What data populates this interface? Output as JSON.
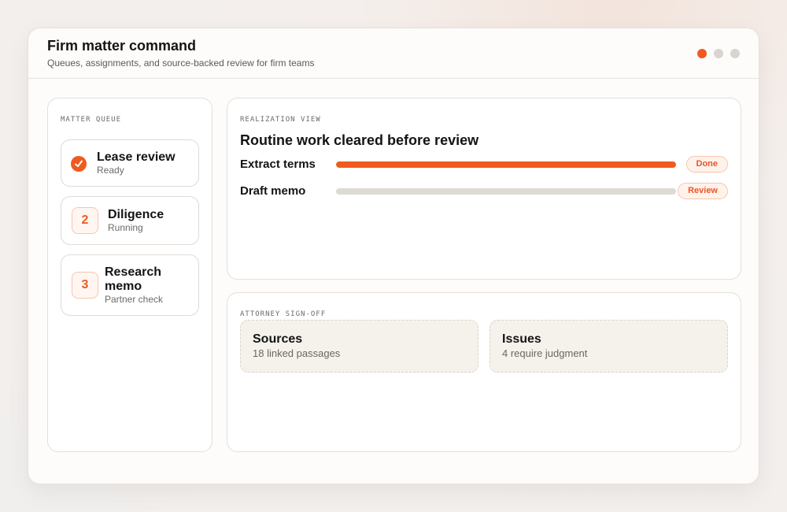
{
  "header": {
    "title": "Firm matter command",
    "subtitle": "Queues, assignments, and source-backed review for firm teams",
    "dots": [
      "active",
      "inactive",
      "inactive"
    ]
  },
  "queue": {
    "label": "MATTER QUEUE",
    "items": [
      {
        "title": "Lease review",
        "status": "Ready",
        "marker": "check-icon"
      },
      {
        "title": "Diligence",
        "status": "Running",
        "marker": "2"
      },
      {
        "title": "Research memo",
        "status": "Partner check",
        "marker": "3"
      }
    ]
  },
  "realization": {
    "label": "REALIZATION VIEW",
    "heading": "Routine work cleared before review",
    "tasks": [
      {
        "label": "Extract terms",
        "progress": 1.0,
        "status": "Done"
      },
      {
        "label": "Draft memo",
        "progress": 0.0,
        "status": "Review"
      }
    ]
  },
  "signoff": {
    "label": "ATTORNEY SIGN-OFF",
    "cards": [
      {
        "title": "Sources",
        "description": "18 linked passages"
      },
      {
        "title": "Issues",
        "description": "4 require judgment"
      }
    ]
  },
  "colors": {
    "accent": "#f05a1f",
    "track": "#dedad4",
    "pill_bg": "#fff2eb"
  }
}
